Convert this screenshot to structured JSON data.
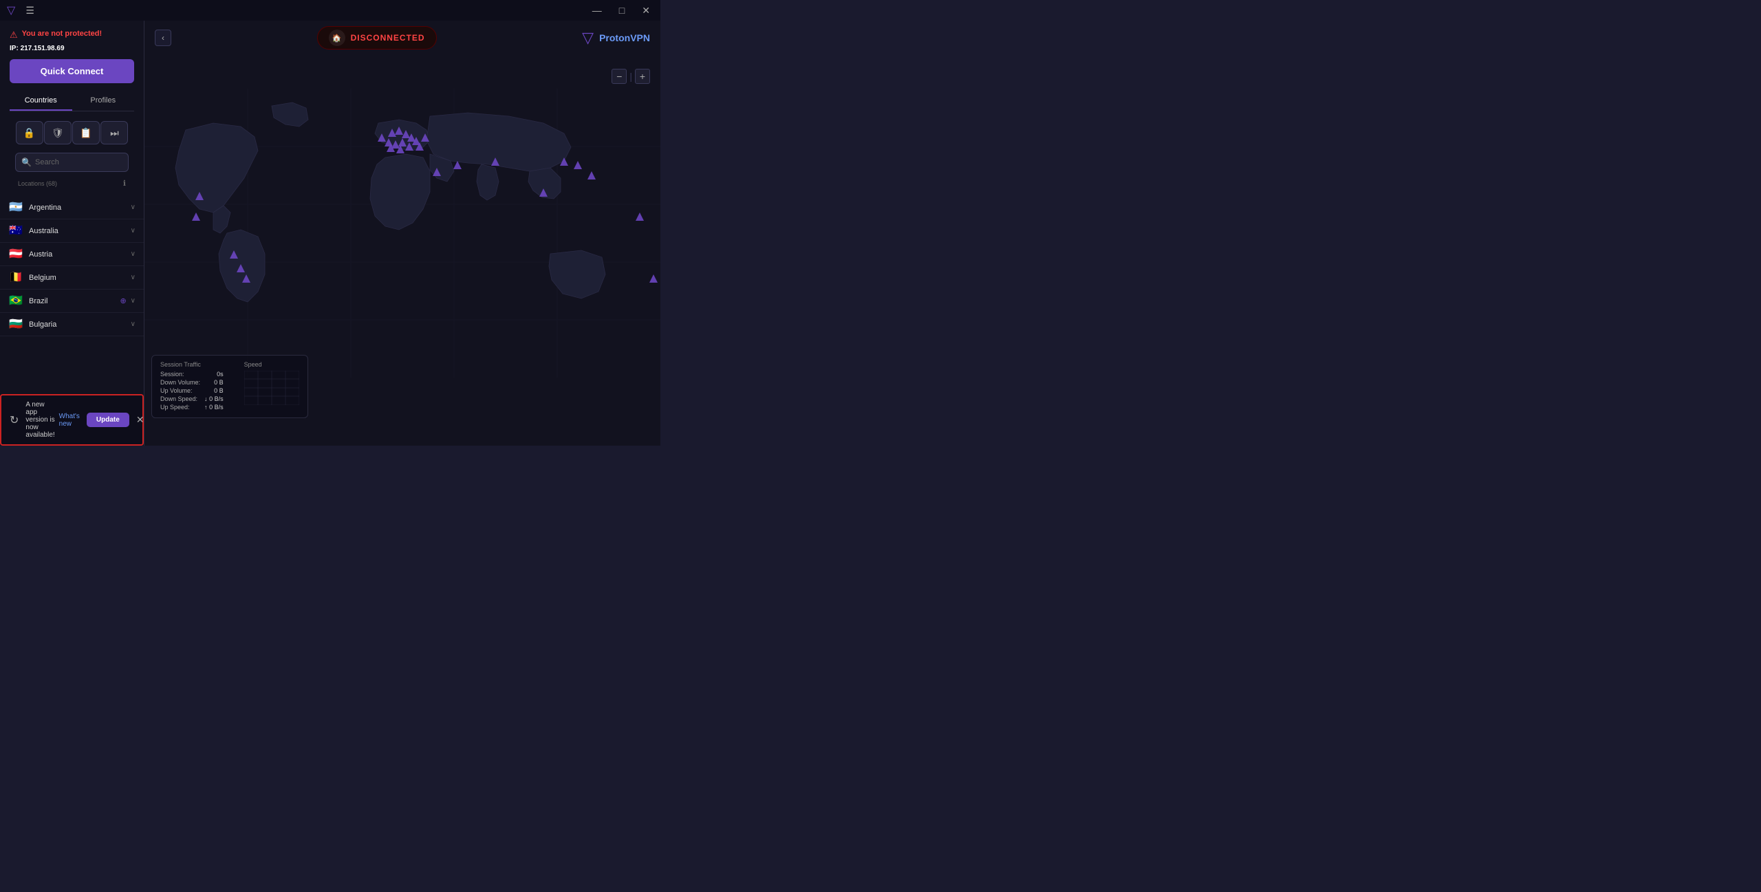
{
  "titlebar": {
    "logo": "▽",
    "menu_label": "☰",
    "minimize_label": "—",
    "maximize_label": "□",
    "close_label": "✕"
  },
  "sidebar": {
    "warning_text": "You are not protected!",
    "ip_label": "IP:",
    "ip_value": "217.151.98.69",
    "quick_connect_label": "Quick Connect",
    "tabs": [
      {
        "label": "Countries",
        "active": true
      },
      {
        "label": "Profiles",
        "active": false
      }
    ],
    "search_placeholder": "Search",
    "locations_label": "Locations (68)",
    "countries": [
      {
        "name": "Argentina",
        "flag": "🇦🇷",
        "has_globe": false
      },
      {
        "name": "Australia",
        "flag": "🇦🇺",
        "has_globe": false
      },
      {
        "name": "Austria",
        "flag": "🇦🇹",
        "has_globe": false
      },
      {
        "name": "Belgium",
        "flag": "🇧🇪",
        "has_globe": false
      },
      {
        "name": "Brazil",
        "flag": "🇧🇷",
        "has_globe": true
      },
      {
        "name": "Bulgaria",
        "flag": "🇧🇬",
        "has_globe": false
      }
    ]
  },
  "map": {
    "status": "DISCONNECTED",
    "logo_text": "Proton",
    "logo_brand": "VPN"
  },
  "stats": {
    "session_label": "Session Traffic",
    "speed_label": "Speed",
    "session": {
      "label": "Session:",
      "value": "0s"
    },
    "down_volume": {
      "label": "Down Volume:",
      "value": "0",
      "unit": "B"
    },
    "up_volume": {
      "label": "Up Volume:",
      "value": "0",
      "unit": "B"
    },
    "down_speed": {
      "label": "Down Speed:",
      "value": "0",
      "unit": "B/s"
    },
    "up_speed": {
      "label": "Up Speed:",
      "value": "0",
      "unit": "B/s"
    }
  },
  "update_bar": {
    "icon": "↻",
    "message": "A new app version is now available!",
    "whats_new_label": "What's new",
    "update_button_label": "Update",
    "close_label": "✕"
  },
  "filter_buttons": [
    {
      "icon": "🔒",
      "label": "secure-core-filter"
    },
    {
      "icon": "🛡",
      "label": "p2p-filter"
    },
    {
      "icon": "📋",
      "label": "smart-filter"
    },
    {
      "icon": "⏭",
      "label": "tor-filter"
    }
  ],
  "vpn_markers": [
    {
      "top": "38%",
      "left": "38%"
    },
    {
      "top": "52%",
      "left": "40%"
    },
    {
      "top": "58%",
      "left": "45%"
    },
    {
      "top": "63%",
      "left": "46%"
    },
    {
      "top": "68%",
      "left": "48%"
    },
    {
      "top": "35%",
      "left": "64%"
    },
    {
      "top": "38%",
      "left": "73%"
    },
    {
      "top": "36%",
      "left": "76%"
    },
    {
      "top": "40%",
      "left": "75%"
    },
    {
      "top": "42%",
      "left": "72%"
    },
    {
      "top": "44%",
      "left": "74%"
    },
    {
      "top": "44%",
      "left": "76%"
    },
    {
      "top": "46%",
      "left": "73%"
    },
    {
      "top": "45%",
      "left": "71%"
    },
    {
      "top": "48%",
      "left": "72%"
    },
    {
      "top": "48%",
      "left": "74%"
    },
    {
      "top": "50%",
      "left": "75%"
    },
    {
      "top": "50%",
      "left": "77%"
    },
    {
      "top": "52%",
      "left": "79%"
    },
    {
      "top": "42%",
      "left": "78%"
    },
    {
      "top": "40%",
      "left": "80%"
    },
    {
      "top": "54%",
      "left": "70%"
    },
    {
      "top": "55%",
      "left": "66%"
    },
    {
      "top": "58%",
      "left": "82%"
    },
    {
      "top": "60%",
      "left": "86%"
    },
    {
      "top": "62%",
      "left": "92%"
    },
    {
      "top": "68%",
      "left": "96%"
    },
    {
      "top": "72%",
      "left": "99%"
    }
  ]
}
